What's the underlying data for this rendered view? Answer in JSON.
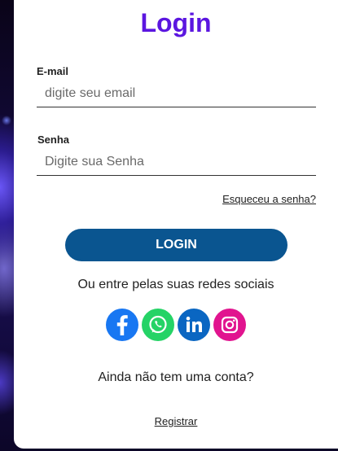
{
  "form": {
    "title": "Login",
    "email_label": "E-mail",
    "email_placeholder": "digite seu email",
    "password_label": "Senha",
    "password_placeholder": "Digite sua Senha",
    "forgot_link": "Esqueceu a senha?",
    "login_button": "LOGIN",
    "social_text": "Ou entre pelas suas redes sociais",
    "no_account_text": "Ainda não tem uma conta?",
    "register_link": "Registrar"
  },
  "socials": [
    {
      "name": "facebook-icon",
      "color": "#1877f2"
    },
    {
      "name": "whatsapp-icon",
      "color": "#25d366"
    },
    {
      "name": "linkedin-icon",
      "color": "#0a66c2"
    },
    {
      "name": "instagram-icon",
      "color": "#e1148f"
    }
  ],
  "colors": {
    "title": "#5b16e0",
    "button": "#0a5590"
  }
}
